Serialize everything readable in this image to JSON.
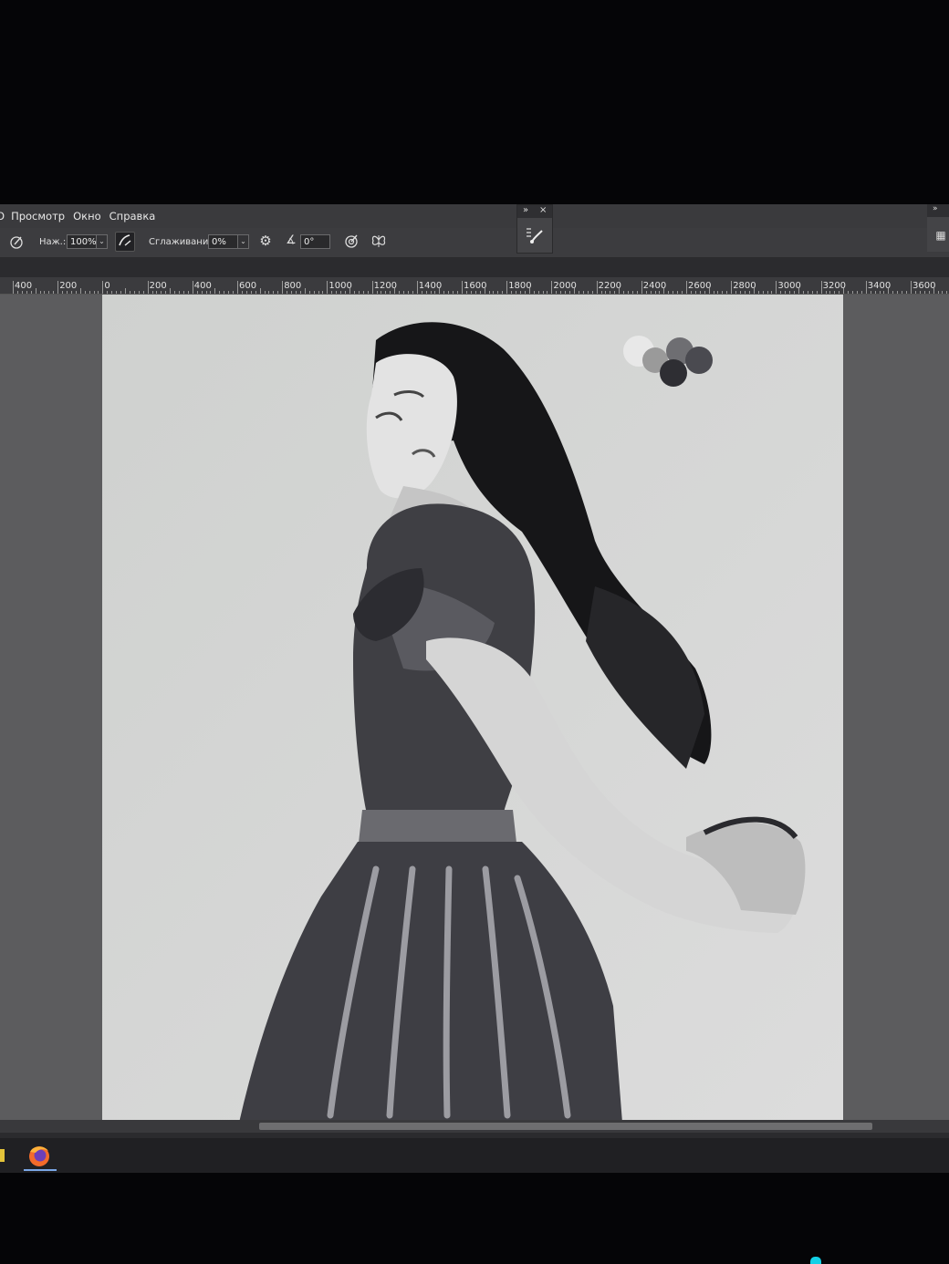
{
  "menu": {
    "cut_item": "О",
    "items": [
      "Просмотр",
      "Окно",
      "Справка"
    ]
  },
  "options": {
    "pressure_label": "Наж.:",
    "pressure_value": "100%",
    "smoothing_label": "Сглаживание:",
    "smoothing_value": "0%",
    "angle_value": "0°"
  },
  "panel": {
    "collapse_glyph": "»",
    "close_glyph": "×"
  },
  "ruler": {
    "labels": [
      "400",
      "200",
      "0",
      "200",
      "400",
      "600",
      "800",
      "1000",
      "1200",
      "1400",
      "1600",
      "1800",
      "2000",
      "2200",
      "2400",
      "2600",
      "2800",
      "3000",
      "3200",
      "3400",
      "3600"
    ]
  },
  "colors": {
    "brand_accent": "#7aa7e6",
    "canvas_bg": "#5c5c5e"
  }
}
